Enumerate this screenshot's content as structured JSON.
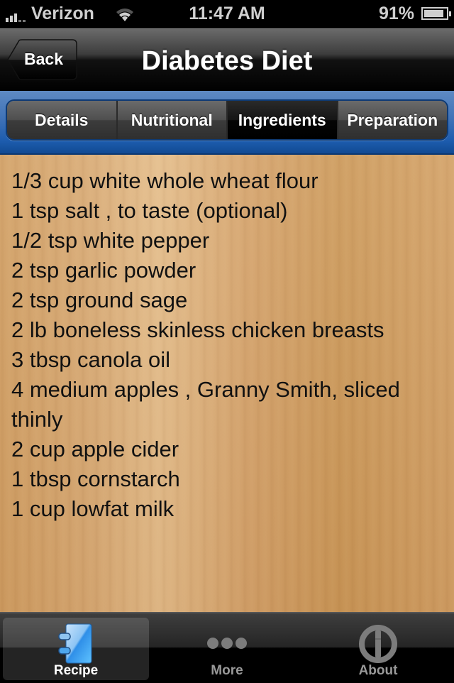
{
  "status_bar": {
    "carrier": "Verizon",
    "time": "11:47 AM",
    "battery_percent": "91%",
    "battery_level": 0.91,
    "signal_bars": 3,
    "icons": [
      "signal-icon",
      "wifi-icon",
      "battery-icon"
    ]
  },
  "nav_bar": {
    "back_label": "Back",
    "title": "Diabetes Diet"
  },
  "segments": {
    "items": [
      {
        "label": "Details",
        "selected": false
      },
      {
        "label": "Nutritional",
        "selected": false
      },
      {
        "label": "Ingredients",
        "selected": true
      },
      {
        "label": "Preparation",
        "selected": false
      }
    ]
  },
  "ingredients": [
    "1/3 cup white whole wheat flour",
    "1 tsp salt , to taste (optional)",
    "1/2 tsp white pepper",
    "2 tsp garlic powder",
    "2 tsp ground sage",
    "2 lb boneless skinless chicken breasts",
    "3 tbsp canola oil",
    "4 medium apples , Granny Smith, sliced thinly",
    "2 cup apple cider",
    "1 tbsp cornstarch",
    "1 cup lowfat milk"
  ],
  "tab_bar": {
    "items": [
      {
        "label": "Recipe",
        "icon": "recipe-book-icon",
        "selected": true
      },
      {
        "label": "More",
        "icon": "more-dots-icon",
        "selected": false
      },
      {
        "label": "About",
        "icon": "info-icon",
        "selected": false
      }
    ]
  },
  "colors": {
    "segment_bar_blue": "#3f72b7",
    "recipe_icon_blue": "#2f9cf0",
    "wood": "#d6a874"
  }
}
